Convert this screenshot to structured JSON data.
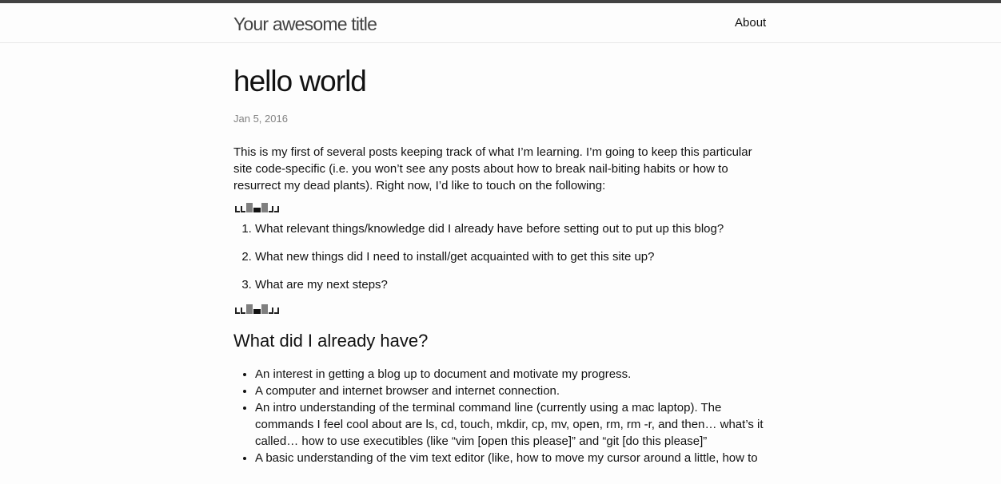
{
  "header": {
    "site_title": "Your awesome title",
    "nav": [
      "About"
    ]
  },
  "post": {
    "title": "hello world",
    "date": "Jan 5, 2016",
    "intro": "This is my first of several posts keeping track of what I’m learning. I’m going to keep this particular site code-specific (i.e. you won’t see any posts about how to break nail-biting habits or how to resurrect my dead plants). Right now, I’d like to touch on the following:",
    "questions": [
      "What relevant things/knowledge did I already have before setting out to put up this blog?",
      "What new things did I need to install/get acquainted with to get this site up?",
      "What are my next steps?"
    ],
    "section1_heading": "What did I already have?",
    "haves": [
      "An interest in getting a blog up to document and motivate my progress.",
      "A computer and internet browser and internet connection.",
      "An intro understanding of the terminal command line (currently using a mac laptop). The commands I feel cool about are ls, cd, touch, mkdir, cp, mv, open, rm, rm -r, and then… what’s it called… how to use executibles (like “vim [open this please]” and “git [do this please]”",
      "A basic understanding of the vim text editor (like, how to move my cursor around a little, how to"
    ]
  }
}
